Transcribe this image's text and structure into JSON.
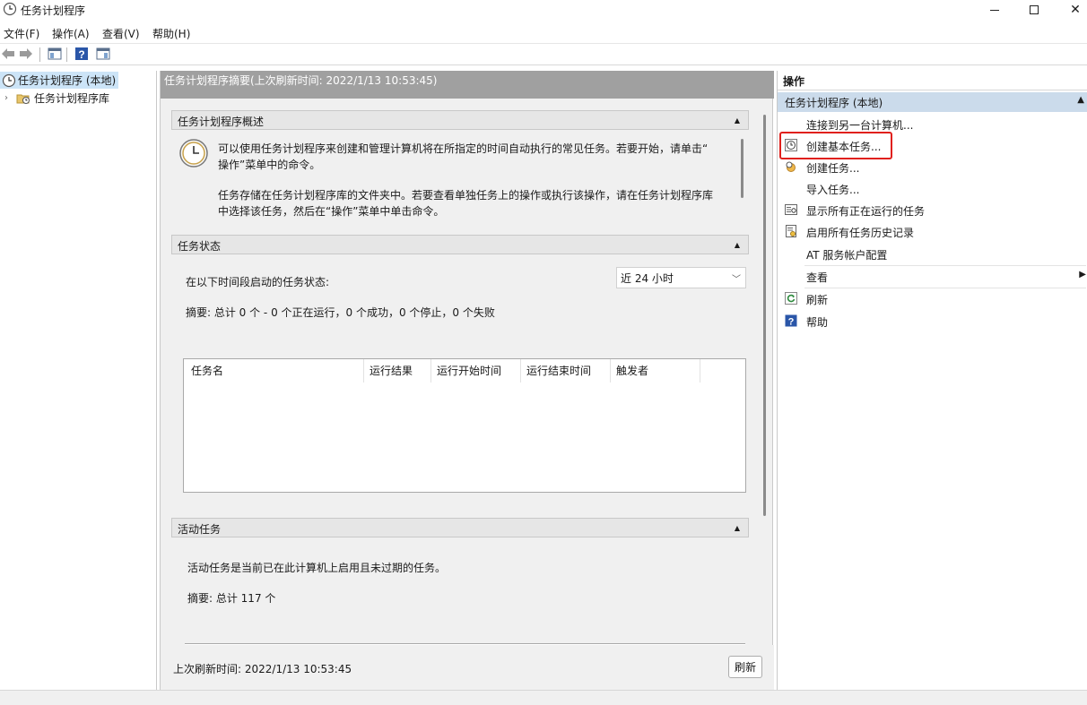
{
  "window": {
    "title": "任务计划程序"
  },
  "menu": [
    "文件(F)",
    "操作(A)",
    "查看(V)",
    "帮助(H)"
  ],
  "tree": {
    "root": "任务计划程序 (本地)",
    "child": "任务计划程序库"
  },
  "center": {
    "header": "任务计划程序摘要(上次刷新时间: 2022/1/13 10:53:45)",
    "overview": {
      "title": "任务计划程序概述",
      "p1_line1": "可以使用任务计划程序来创建和管理计算机将在所指定的时间自动执行的常见任务。若要开始，请单击“",
      "p1_line2": "操作”菜单中的命令。",
      "p2_line1": "任务存储在任务计划程序库的文件夹中。若要查看单独任务上的操作或执行该操作，请在任务计划程序库",
      "p2_line2": "中选择该任务，然后在“操作”菜单中单击命令。"
    },
    "status": {
      "title": "任务状态",
      "label": "在以下时间段启动的任务状态:",
      "range": "近 24 小时",
      "summary": "摘要: 总计 0 个 - 0 个正在运行，0 个成功，0 个停止，0 个失败",
      "columns": [
        "任务名",
        "运行结果",
        "运行开始时间",
        "运行结束时间",
        "触发者"
      ]
    },
    "active": {
      "title": "活动任务",
      "desc": "活动任务是当前已在此计算机上启用且未过期的任务。",
      "summary": "摘要: 总计 117 个"
    },
    "footer": {
      "last_refresh": "上次刷新时间: 2022/1/13 10:53:45",
      "refresh": "刷新"
    }
  },
  "actions": {
    "title": "操作",
    "group": "任务计划程序 (本地)",
    "items": [
      {
        "label": "连接到另一台计算机...",
        "icon": "none"
      },
      {
        "label": "创建基本任务...",
        "icon": "clock-icon"
      },
      {
        "label": "创建任务...",
        "icon": "task-icon"
      },
      {
        "label": "导入任务...",
        "icon": "none"
      },
      {
        "label": "显示所有正在运行的任务",
        "icon": "list-icon"
      },
      {
        "label": "启用所有任务历史记录",
        "icon": "history-icon"
      },
      {
        "label": "AT 服务帐户配置",
        "icon": "none"
      },
      {
        "label": "查看",
        "icon": "none"
      },
      {
        "label": "刷新",
        "icon": "refresh-icon"
      },
      {
        "label": "帮助",
        "icon": "help-icon"
      }
    ]
  },
  "colors": {
    "highlight": "#e0201c",
    "selection": "#cce4f7",
    "group": "#cbdbeb"
  }
}
